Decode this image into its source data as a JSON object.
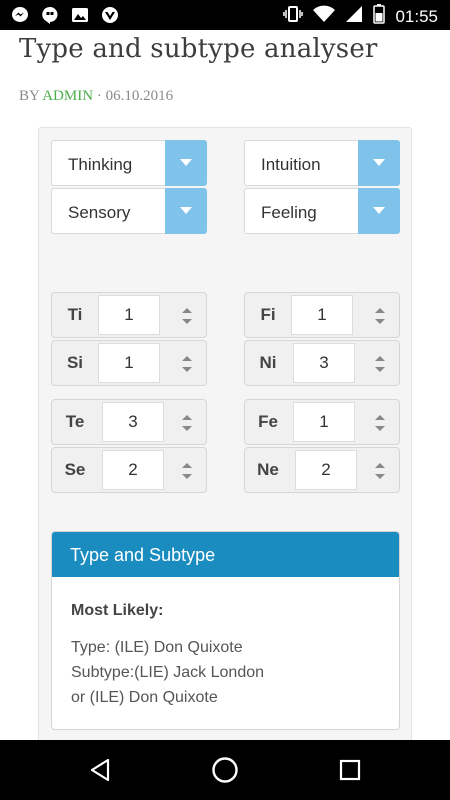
{
  "status_bar": {
    "time": "01:55",
    "left_icons": [
      "messenger-icon",
      "hangouts-icon",
      "gallery-icon",
      "vpn-icon"
    ],
    "right_icons": [
      "vibrate-icon",
      "wifi-icon",
      "signal-icon",
      "battery-icon"
    ]
  },
  "header": {
    "title": "Type and subtype analyser",
    "by_prefix": "BY",
    "author": "ADMIN",
    "separator": "·",
    "date": "06.10.2016"
  },
  "dichotomies": [
    {
      "label": "Thinking"
    },
    {
      "label": "Intuition"
    },
    {
      "label": "Sensory"
    },
    {
      "label": "Feeling"
    }
  ],
  "functions": [
    {
      "name": "Ti",
      "value": "1"
    },
    {
      "name": "Fi",
      "value": "1"
    },
    {
      "name": "Si",
      "value": "1"
    },
    {
      "name": "Ni",
      "value": "3"
    },
    {
      "name": "Te",
      "value": "3"
    },
    {
      "name": "Fe",
      "value": "1"
    },
    {
      "name": "Se",
      "value": "2"
    },
    {
      "name": "Ne",
      "value": "2"
    }
  ],
  "result": {
    "heading": "Type and Subtype",
    "most_likely_label": "Most Likely:",
    "type_line": "Type: (ILE) Don Quixote",
    "subtype_line": "Subtype:(LIE) Jack London",
    "alt_line": "or (ILE) Don Quixote"
  },
  "colors": {
    "accent_blue": "#1a8cc0",
    "dropdown_arrow_bg": "#7fc2ea",
    "author_green": "#4cae4c"
  },
  "nav_bar": {
    "icons": [
      "back-icon",
      "home-icon",
      "recents-icon"
    ]
  }
}
